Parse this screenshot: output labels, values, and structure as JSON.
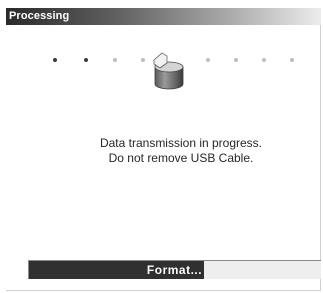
{
  "dialog": {
    "title": "Processing",
    "message_line1": "Data transmission in progress.",
    "message_line2": "Do not remove USB Cable.",
    "icon": "usb-drive-icon"
  },
  "progress": {
    "label": "Format...",
    "fraction": 0.6,
    "fill_color": "#303030",
    "track_color": "#eeeeee"
  },
  "animation": {
    "dot_count": 9,
    "active_dots": [
      0,
      1
    ],
    "highlight_color": "#3c3c3c",
    "dim_color": "#bdbdbd"
  }
}
